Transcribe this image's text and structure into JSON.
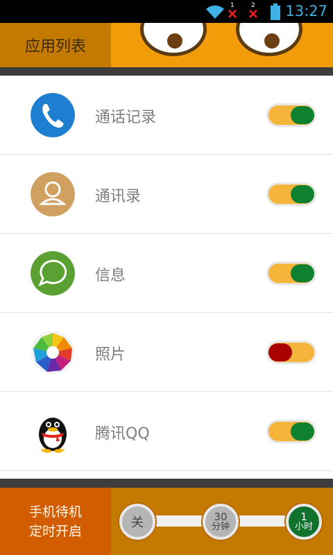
{
  "status_bar": {
    "time": "13:27",
    "sim1_label": "1",
    "sim2_label": "2",
    "icons": [
      "wifi-icon",
      "sim1-no-signal-icon",
      "sim2-no-signal-icon",
      "battery-icon"
    ]
  },
  "header": {
    "title": "应用列表"
  },
  "apps": [
    {
      "label": "通话记录",
      "icon": "phone-icon",
      "enabled": true
    },
    {
      "label": "通讯录",
      "icon": "contacts-icon",
      "enabled": true
    },
    {
      "label": "信息",
      "icon": "message-icon",
      "enabled": true
    },
    {
      "label": "照片",
      "icon": "photos-icon",
      "enabled": false
    },
    {
      "label": "腾讯QQ",
      "icon": "qq-icon",
      "enabled": true
    }
  ],
  "timer": {
    "caption_line1": "手机待机",
    "caption_line2": "定时开启",
    "options": [
      {
        "line1": "关",
        "line2": ""
      },
      {
        "line1": "30",
        "line2": "分钟"
      },
      {
        "line1": "1",
        "line2": "小时"
      }
    ],
    "selected_index": 2
  },
  "colors": {
    "header_orange": "#f39c09",
    "title_block": "#c47a00",
    "toggle_on": "#0e8130",
    "toggle_off": "#aa0000",
    "toggle_track": "#f5b43a",
    "timer_caption_bg": "#d25d00"
  }
}
